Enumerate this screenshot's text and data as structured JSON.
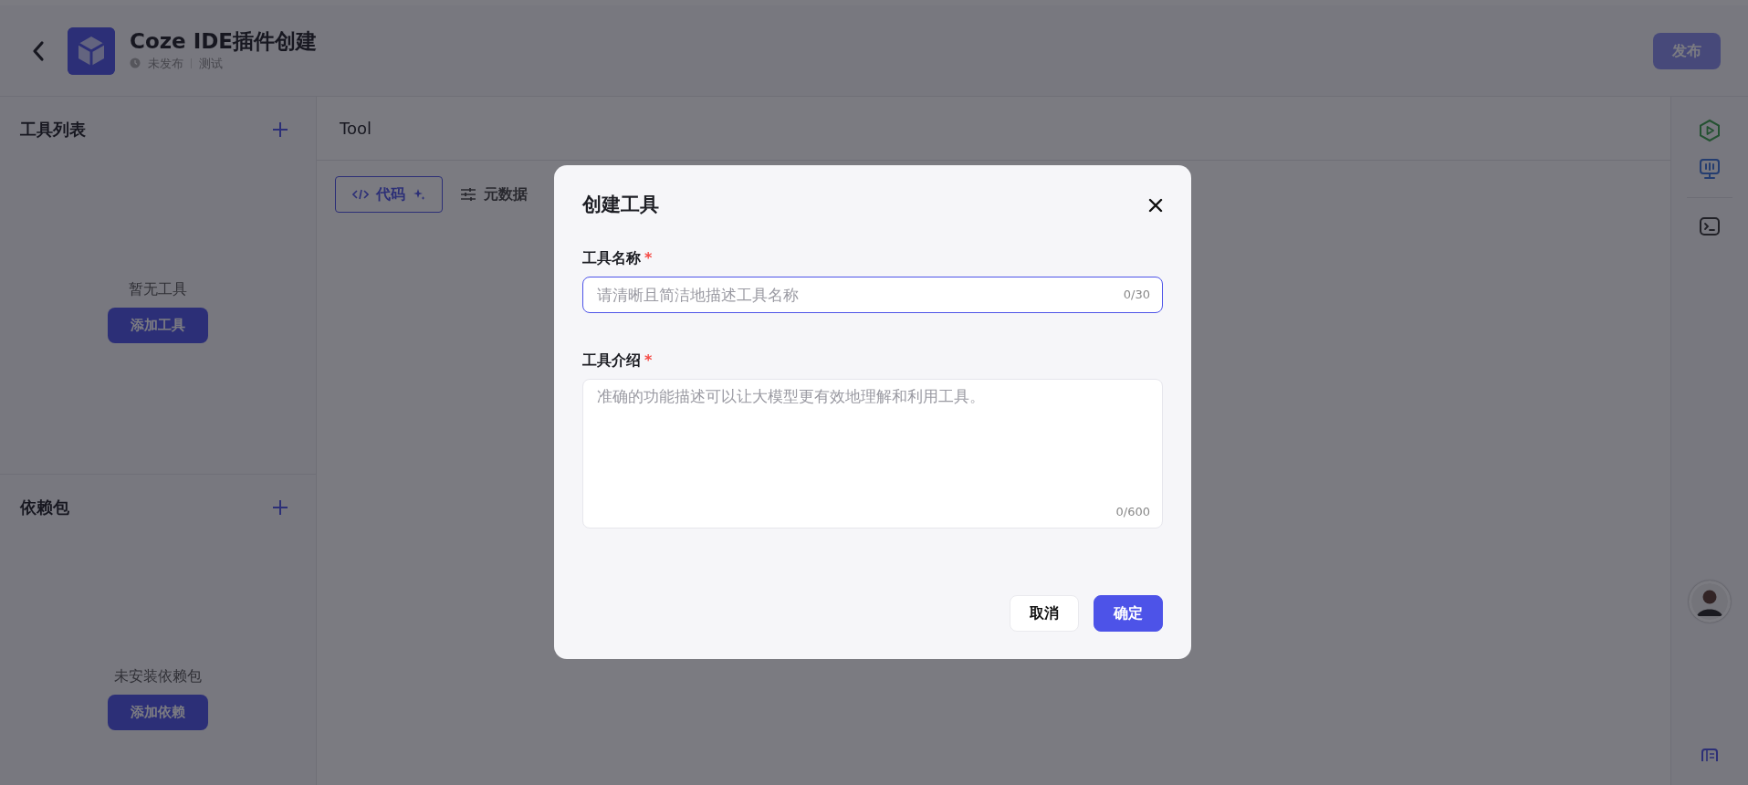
{
  "header": {
    "title": "Coze IDE插件创建",
    "status": "未发布",
    "environment": "测试",
    "publish_button": {
      "label": "发布",
      "disabled": true
    }
  },
  "sidebar": {
    "sections": [
      {
        "title": "工具列表",
        "empty_text": "暂无工具",
        "button": "添加工具"
      },
      {
        "title": "依赖包",
        "empty_text": "未安装依赖包",
        "button": "添加依赖"
      }
    ]
  },
  "main": {
    "title": "Tool",
    "tabs": [
      {
        "label": "代码",
        "selected": true
      },
      {
        "label": "元数据",
        "selected": false
      }
    ]
  },
  "dialog": {
    "title": "创建工具",
    "fields": [
      {
        "kind": "input",
        "label": "工具名称",
        "required_mark": "*",
        "placeholder": "请清晰且简洁地描述工具名称",
        "counter": "0/30",
        "focused": true
      },
      {
        "kind": "textarea",
        "label": "工具介绍",
        "required_mark": "*",
        "placeholder": "准确的功能描述可以让大模型更有效地理解和利用工具。",
        "counter": "0/600",
        "focused": false
      }
    ],
    "buttons": [
      {
        "label": "取消",
        "primary": false
      },
      {
        "label": "确定",
        "primary": true
      }
    ]
  }
}
